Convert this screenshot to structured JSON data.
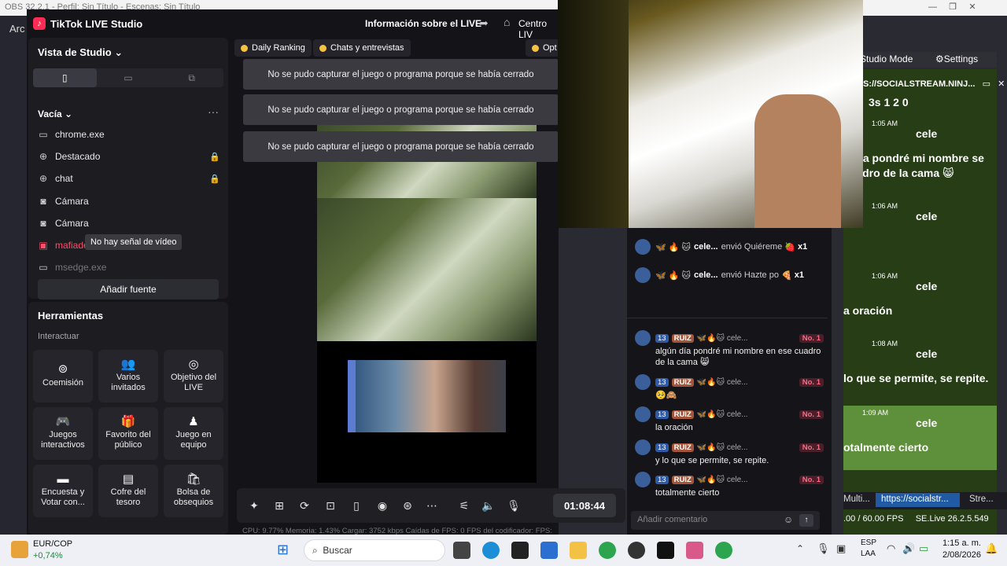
{
  "obs": {
    "title": "OBS 32.2.1 - Perfil: Sin Título - Escenas: Sin Título",
    "menu_partial": "Arc",
    "studio_mode": "Studio Mode",
    "settings": "Settings",
    "browser_url": "S://SOCIALSTREAM.NINJ...",
    "bottom_tab_1": "Multi...",
    "bottom_tab_url": "https://socialstr...",
    "bottom_tab_3": "Stre...",
    "fps_status": ".00 / 60.00 FPS",
    "version": "SE.Live 26.2.5.549"
  },
  "tiktok": {
    "app_title": "TikTok LIVE Studio",
    "live_info": "Información sobre el LIVE",
    "centro": "Centro LIV",
    "studio_view": "Vista de Studio",
    "scene_name": "Vacía",
    "sources": [
      {
        "label": "chrome.exe",
        "icon": "app-icon",
        "locked": false
      },
      {
        "label": "Destacado",
        "icon": "globe-icon",
        "locked": true
      },
      {
        "label": "chat",
        "icon": "globe-icon",
        "locked": true
      },
      {
        "label": "Cámara",
        "icon": "camera-icon",
        "locked": false
      },
      {
        "label": "Cámara",
        "icon": "camera-icon",
        "locked": false
      },
      {
        "label": "mafiadefinitiveediti",
        "icon": "game-icon",
        "locked": false
      },
      {
        "label": "msedge.exe",
        "icon": "app-icon",
        "locked": false
      }
    ],
    "tooltip": "No hay señal de vídeo",
    "add_source": "Añadir fuente",
    "tools_title": "Herramientas",
    "interact_label": "Interactuar",
    "tools": [
      {
        "label": "Coemisión",
        "icon": "link-icon"
      },
      {
        "label": "Varios invitados",
        "icon": "users-icon"
      },
      {
        "label": "Objetivo del LIVE",
        "icon": "target-icon"
      },
      {
        "label": "Juegos interactivos",
        "icon": "gamepad-icon"
      },
      {
        "label": "Favorito del público",
        "icon": "gift-icon"
      },
      {
        "label": "Juego en equipo",
        "icon": "team-icon"
      },
      {
        "label": "Encuesta y Votar con...",
        "icon": "poll-icon"
      },
      {
        "label": "Cofre del tesoro",
        "icon": "chest-icon"
      },
      {
        "label": "Bolsa de obsequios",
        "icon": "bag-icon"
      }
    ],
    "tabs": [
      "Daily Ranking",
      "Chats y entrevistas",
      "Opt"
    ],
    "error_message": "No se pudo capturar el juego o programa porque se había cerrado",
    "timer": "01:08:44",
    "stats": "CPU: 9.77%     Memoria: 1.43%     Cargar: 3752 kbps     Caídas de FPS: 0     FPS del codificador:     FPS:"
  },
  "chat": {
    "gifts": [
      {
        "user": "cele...",
        "action": "envió Quiéreme",
        "count": "x1"
      },
      {
        "user": "cele...",
        "action": "envió Hazte po",
        "count": "x1"
      }
    ],
    "messages": [
      {
        "level": "13",
        "fan": "RUIZ",
        "user": "cele...",
        "rank": "No. 1",
        "text": "algún día pondré mi nombre en ese cuadro de la cama 😸"
      },
      {
        "level": "13",
        "fan": "RUIZ",
        "user": "cele...",
        "rank": "No. 1",
        "text": "🥺🙈"
      },
      {
        "level": "13",
        "fan": "RUIZ",
        "user": "cele...",
        "rank": "No. 1",
        "text": "la oración"
      },
      {
        "level": "13",
        "fan": "RUIZ",
        "user": "cele...",
        "rank": "No. 1",
        "text": "y lo que se permite, se repite."
      },
      {
        "level": "13",
        "fan": "RUIZ",
        "user": "cele...",
        "rank": "No. 1",
        "text": "totalmente cierto"
      }
    ],
    "input_placeholder": "Añadir comentario"
  },
  "social_stream": {
    "counts": "3s   1   2   0",
    "name": "cele",
    "entries": [
      {
        "time": "1:05 AM",
        "text": "n día pondré mi nombre se cuadro de la cama 😸"
      },
      {
        "time": "1:06 AM",
        "text": ""
      },
      {
        "time": "1:06 AM",
        "text": "a oración"
      },
      {
        "time": "1:08 AM",
        "text": "lo que se permite, se repite."
      },
      {
        "time": "1:09 AM",
        "text": "otalmente cierto"
      }
    ]
  },
  "taskbar": {
    "currency": "EUR/COP",
    "change": "+0,74%",
    "search": "Buscar",
    "lang": "ESP",
    "lang2": "LAA",
    "time": "1:15 a. m.",
    "date": "2/08/2026"
  }
}
